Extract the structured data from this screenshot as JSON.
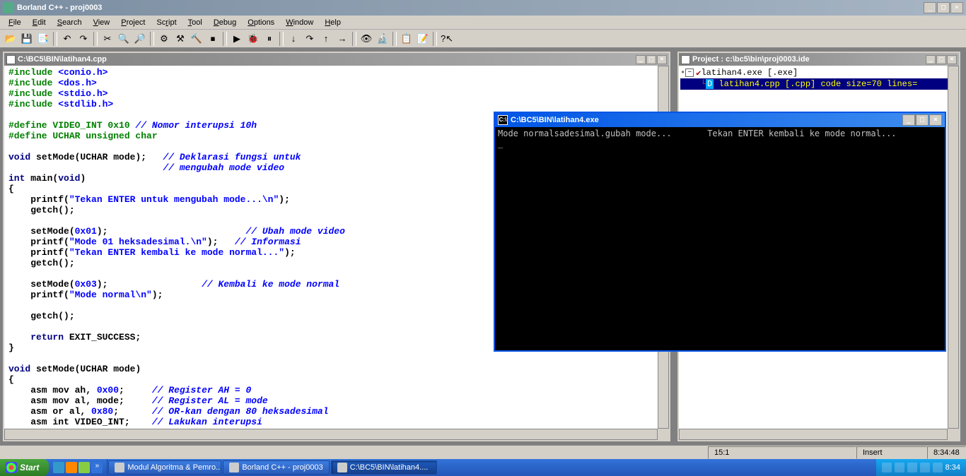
{
  "app": {
    "title": "Borland C++ - proj0003"
  },
  "menu": {
    "items": [
      "File",
      "Edit",
      "Search",
      "View",
      "Project",
      "Script",
      "Tool",
      "Debug",
      "Options",
      "Window",
      "Help"
    ]
  },
  "editor": {
    "title": "C:\\BC5\\BIN\\latihan4.cpp",
    "code_tokens": [
      [
        [
          "g",
          "#include "
        ],
        [
          "b",
          "<conio.h>"
        ]
      ],
      [
        [
          "g",
          "#include "
        ],
        [
          "b",
          "<dos.h>"
        ]
      ],
      [
        [
          "g",
          "#include "
        ],
        [
          "b",
          "<stdio.h>"
        ]
      ],
      [
        [
          "g",
          "#include "
        ],
        [
          "b",
          "<stdlib.h>"
        ]
      ],
      [],
      [
        [
          "g",
          "#define VIDEO_INT 0x10 "
        ],
        [
          "c",
          "// Nomor interupsi 10h"
        ]
      ],
      [
        [
          "g",
          "#define UCHAR unsigned char"
        ]
      ],
      [],
      [
        [
          "k",
          "void"
        ],
        [
          "p",
          " setMode(UCHAR mode);   "
        ],
        [
          "c",
          "// Deklarasi fungsi untuk"
        ]
      ],
      [
        [
          "p",
          "                            "
        ],
        [
          "c",
          "// mengubah mode video"
        ]
      ],
      [
        [
          "k",
          "int"
        ],
        [
          "p",
          " main("
        ],
        [
          "k",
          "void"
        ],
        [
          "p",
          ")"
        ]
      ],
      [
        [
          "p",
          "{"
        ]
      ],
      [
        [
          "p",
          "    printf("
        ],
        [
          "b",
          "\"Tekan ENTER untuk mengubah mode...\\n\""
        ],
        [
          "p",
          ");"
        ]
      ],
      [
        [
          "p",
          "    getch();"
        ]
      ],
      [],
      [
        [
          "p",
          "    setMode("
        ],
        [
          "b",
          "0x01"
        ],
        [
          "p",
          ");                         "
        ],
        [
          "c",
          "// Ubah mode video"
        ]
      ],
      [
        [
          "p",
          "    printf("
        ],
        [
          "b",
          "\"Mode 01 heksadesimal.\\n\""
        ],
        [
          "p",
          ");   "
        ],
        [
          "c",
          "// Informasi"
        ]
      ],
      [
        [
          "p",
          "    printf("
        ],
        [
          "b",
          "\"Tekan ENTER kembali ke mode normal...\""
        ],
        [
          "p",
          ");"
        ]
      ],
      [
        [
          "p",
          "    getch();"
        ]
      ],
      [],
      [
        [
          "p",
          "    setMode("
        ],
        [
          "b",
          "0x03"
        ],
        [
          "p",
          ");                 "
        ],
        [
          "c",
          "// Kembali ke mode normal"
        ]
      ],
      [
        [
          "p",
          "    printf("
        ],
        [
          "b",
          "\"Mode normal\\n\""
        ],
        [
          "p",
          ");"
        ]
      ],
      [],
      [
        [
          "p",
          "    getch();"
        ]
      ],
      [],
      [
        [
          "p",
          "    "
        ],
        [
          "k",
          "return"
        ],
        [
          "p",
          " EXIT_SUCCESS;"
        ]
      ],
      [
        [
          "p",
          "}"
        ]
      ],
      [],
      [
        [
          "k",
          "void"
        ],
        [
          "p",
          " setMode(UCHAR mode)"
        ]
      ],
      [
        [
          "p",
          "{"
        ]
      ],
      [
        [
          "p",
          "    asm mov ah, "
        ],
        [
          "b",
          "0x00"
        ],
        [
          "p",
          ";     "
        ],
        [
          "c",
          "// Register AH = 0"
        ]
      ],
      [
        [
          "p",
          "    asm mov al, mode;     "
        ],
        [
          "c",
          "// Register AL = mode"
        ]
      ],
      [
        [
          "p",
          "    asm or al, "
        ],
        [
          "b",
          "0x80"
        ],
        [
          "p",
          ";      "
        ],
        [
          "c",
          "// OR-kan dengan 80 heksadesimal"
        ]
      ],
      [
        [
          "p",
          "    asm int VIDEO_INT;    "
        ],
        [
          "c",
          "// Lakukan interupsi"
        ]
      ]
    ]
  },
  "project": {
    "title": "Project : c:\\bc5\\bin\\proj0003.ide",
    "root": "latihan4.exe [.exe]",
    "child": "latihan4.cpp [.cpp]  code size=70  lines="
  },
  "console": {
    "title": "C:\\BC5\\BIN\\latihan4.exe",
    "line1": "Mode normalsadesimal.gubah mode...       Tekan ENTER kembali ke mode normal...",
    "cursor": "_"
  },
  "status": {
    "pos": "15:1",
    "mode": "Insert",
    "time": "8:34:48"
  },
  "taskbar": {
    "start": "Start",
    "tasks": [
      {
        "label": "Modul Algoritma & Pemro...",
        "active": false
      },
      {
        "label": "Borland C++ - proj0003",
        "active": false
      },
      {
        "label": "C:\\BC5\\BIN\\latihan4....",
        "active": true
      }
    ],
    "clock": "8:34"
  }
}
